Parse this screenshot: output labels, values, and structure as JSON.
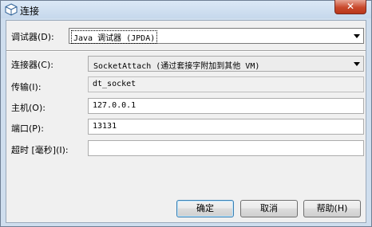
{
  "window": {
    "title": "连接",
    "close_glyph": "✕"
  },
  "debugger": {
    "label": "调试器(D):",
    "selected": "Java 调试器 (JPDA)"
  },
  "connector": {
    "label": "连接器(C):",
    "selected": "SocketAttach (通过套接字附加到其他 VM)"
  },
  "transport": {
    "label": "传输(I):",
    "value": "dt_socket"
  },
  "host": {
    "label": "主机(O):",
    "value": "127.0.0.1"
  },
  "port": {
    "label": "端口(P):",
    "value": "13131"
  },
  "timeout": {
    "label": "超时 [毫秒](I):",
    "value": ""
  },
  "buttons": {
    "ok": "确定",
    "cancel": "取消",
    "help": "帮助(H)"
  },
  "colors": {
    "titlebar": "#c6d8ec",
    "close": "#c9492c",
    "dialog_bg": "#f0f0f0"
  }
}
